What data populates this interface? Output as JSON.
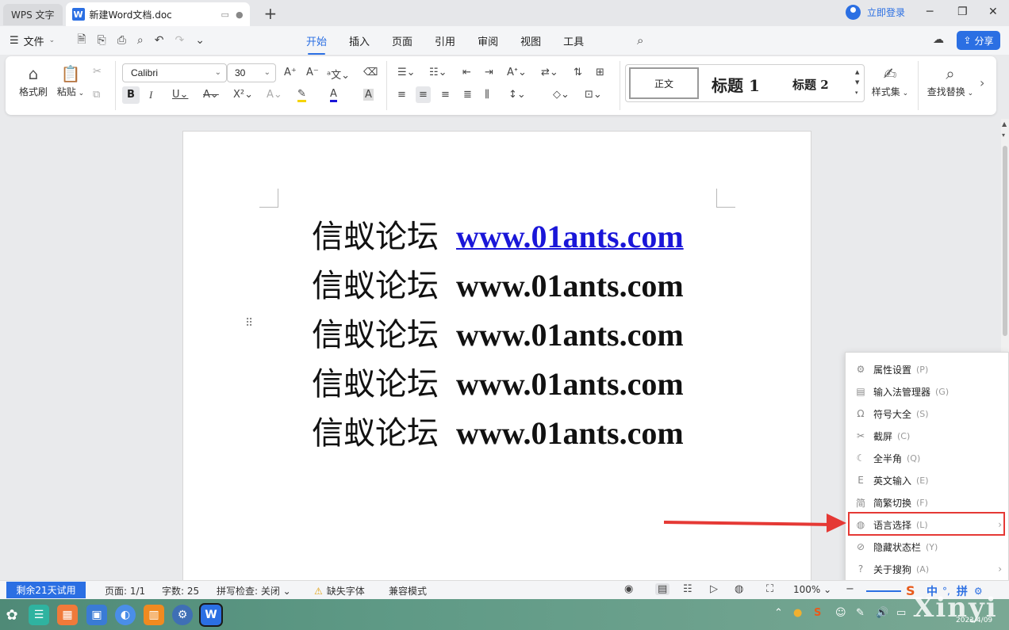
{
  "titlebar": {
    "app_tab": "WPS 文字",
    "doc_tab": "新建Word文档.doc",
    "login": "立即登录"
  },
  "menubar": {
    "file": "文件",
    "tabs": [
      "开始",
      "插入",
      "页面",
      "引用",
      "审阅",
      "视图",
      "工具"
    ],
    "active_tab": "开始",
    "share": "分享"
  },
  "ribbon": {
    "format_painter": "格式刷",
    "paste": "粘贴",
    "font_name": "Calibri",
    "font_size": "30",
    "styles": {
      "normal": "正文",
      "h1": "标题 1",
      "h2": "标题 2"
    },
    "style_set": "样式集",
    "find_replace": "查找替换"
  },
  "document": {
    "lines": [
      {
        "cn": "信蚁论坛",
        "url": "www.01ants.com",
        "link": true
      },
      {
        "cn": "信蚁论坛",
        "url": "www.01ants.com",
        "link": false
      },
      {
        "cn": "信蚁论坛",
        "url": "www.01ants.com",
        "link": false
      },
      {
        "cn": "信蚁论坛",
        "url": "www.01ants.com",
        "link": false
      },
      {
        "cn": "信蚁论坛",
        "url": "www.01ants.com",
        "link": false
      }
    ]
  },
  "context_menu": {
    "items": [
      {
        "label": "属性设置",
        "key": "(P)",
        "icon": "gear-icon",
        "submenu": false
      },
      {
        "label": "输入法管理器",
        "key": "(G)",
        "icon": "manager-icon",
        "submenu": false
      },
      {
        "label": "符号大全",
        "key": "(S)",
        "icon": "omega-icon",
        "submenu": false
      },
      {
        "label": "截屏",
        "key": "(C)",
        "icon": "scissors-icon",
        "submenu": false
      },
      {
        "label": "全半角",
        "key": "(Q)",
        "icon": "moon-icon",
        "submenu": false
      },
      {
        "label": "英文输入",
        "key": "(E)",
        "icon": "letter-e-icon",
        "submenu": false
      },
      {
        "label": "简繁切换",
        "key": "(F)",
        "icon": "jian-icon",
        "submenu": false
      },
      {
        "label": "语言选择",
        "key": "(L)",
        "icon": "globe-icon",
        "submenu": true
      },
      {
        "label": "隐藏状态栏",
        "key": "(Y)",
        "icon": "hide-icon",
        "submenu": false
      },
      {
        "label": "关于搜狗",
        "key": "(A)",
        "icon": "help-icon",
        "submenu": true
      }
    ],
    "highlighted": "语言选择"
  },
  "statusbar": {
    "trial": "剩余21天试用",
    "page": "页面: 1/1",
    "word_count": "字数: 25",
    "spell_check": "拼写检查: 关闭",
    "missing_font": "缺失字体",
    "compat_mode": "兼容模式",
    "zoom": "100%"
  },
  "ime": {
    "lang": "中",
    "mode": "拼"
  },
  "taskbar": {
    "watermark": "Xinyi",
    "date": "2023/4/09"
  },
  "colors": {
    "accent": "#2b6fe3",
    "link": "#1a16d8",
    "annotation": "#e53935"
  }
}
